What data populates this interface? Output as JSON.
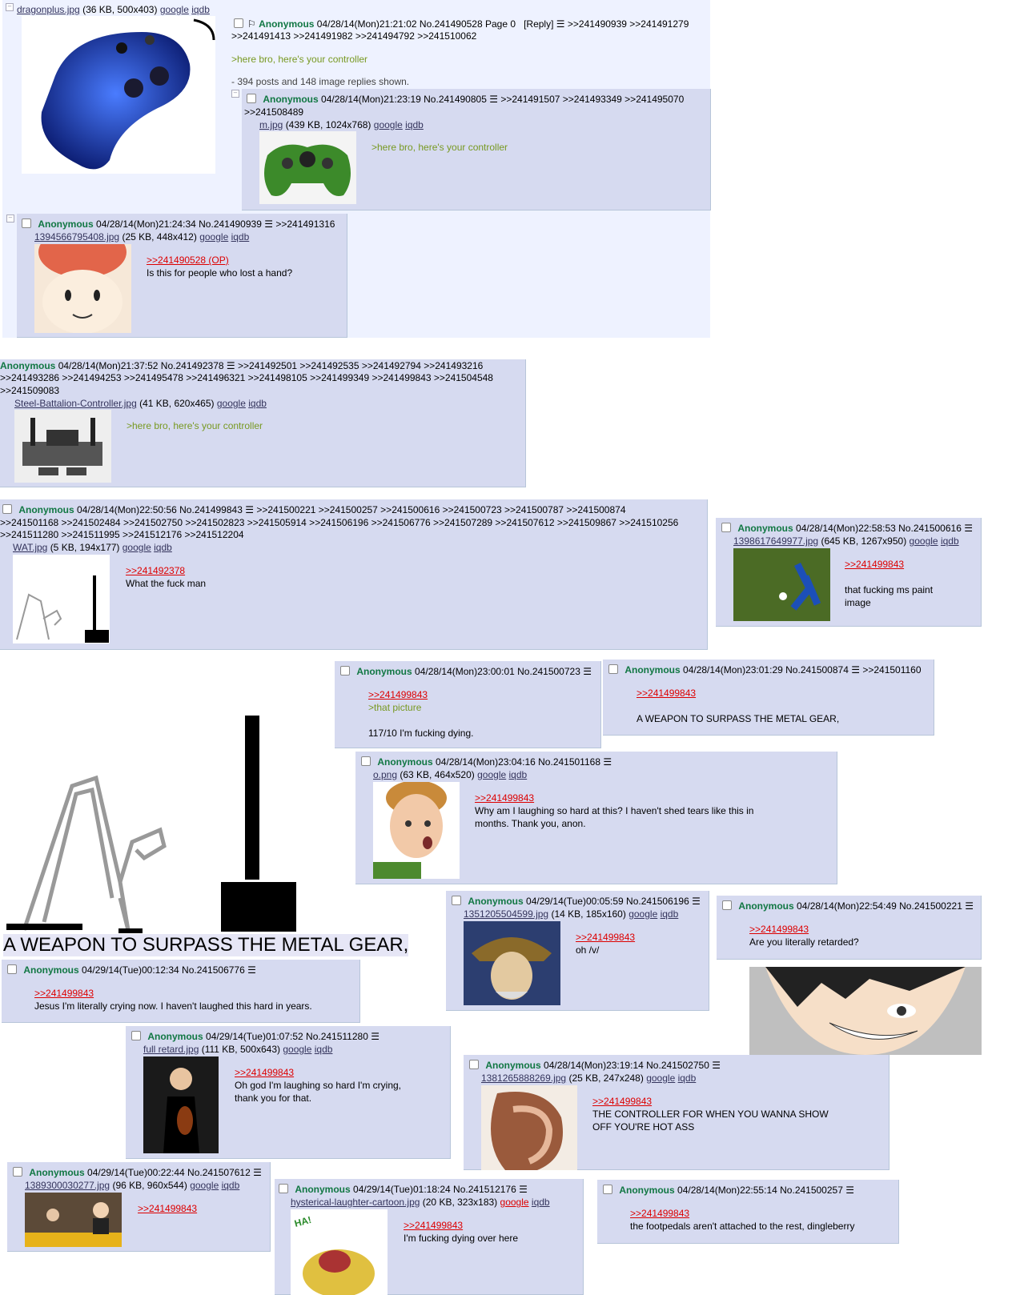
{
  "op": {
    "file_name": "dragonplus.jpg",
    "file_meta": "(36 KB, 500x403)",
    "name": "Anonymous",
    "date": "04/28/14(Mon)21:21:02",
    "no": "No.241490528",
    "page": "Page 0",
    "reply": "[Reply]",
    "replies_line1": ">>241490939 >>241491279",
    "replies_line2": ">>241491413 >>241491982 >>241494792 >>241510062",
    "body": ">here bro, here's your controller",
    "omitted": "- 394 posts and 148 image replies shown."
  },
  "google": "google",
  "iqdb": "iqdb",
  "posts": [
    {
      "name": "Anonymous",
      "date": "04/28/14(Mon)21:23:19",
      "no": "No.241490805",
      "replies": ">>241491507 >>241493349 >>241495070",
      "replies2": ">>241508489",
      "file": "m.jpg",
      "meta": "(439 KB, 1024x768)",
      "body1": ">here bro, here's your controller"
    },
    {
      "name": "Anonymous",
      "date": "04/28/14(Mon)21:24:34",
      "no": "No.241490939",
      "replies": ">>241491316",
      "file": "1394566795408.jpg",
      "meta": "(25 KB, 448x412)",
      "quote": ">>241490528 (OP)",
      "body1": "Is this for people who lost a hand?"
    },
    {
      "name": "Anonymous",
      "date": "04/28/14(Mon)21:37:52",
      "no": "No.241492378",
      "replies": ">>241492501 >>241492535 >>241492794 >>241493216",
      "replies2": ">>241493286 >>241494253 >>241495478 >>241496321 >>241498105 >>241499349 >>241499843 >>241504548",
      "replies3": ">>241509083",
      "file": "Steel-Battalion-Controller.jpg",
      "meta": "(41 KB, 620x465)",
      "body1": ">here bro, here's your controller"
    },
    {
      "name": "Anonymous",
      "date": "04/28/14(Mon)22:50:56",
      "no": "No.241499843",
      "replies": ">>241500221 >>241500257 >>241500616 >>241500723 >>241500787 >>241500874",
      "replies2": ">>241501168 >>241502484 >>241502750 >>241502823 >>241505914 >>241506196 >>241506776 >>241507289 >>241507612 >>241509867 >>241510256",
      "replies3": ">>241511280 >>241511995 >>241512176 >>241512204",
      "file": "WAT.jpg",
      "meta": "(5 KB, 194x177)",
      "quote": ">>241492378",
      "body1": "What the fuck man"
    },
    {
      "name": "Anonymous",
      "date": "04/28/14(Mon)22:58:53",
      "no": "No.241500616",
      "file": "1398617649977.jpg",
      "meta": "(645 KB, 1267x950)",
      "quote": ">>241499843",
      "body1": "that fucking ms paint",
      "body2": "image"
    },
    {
      "name": "Anonymous",
      "date": "04/28/14(Mon)23:00:01",
      "no": "No.241500723",
      "quote": ">>241499843",
      "gt": ">that picture",
      "body1": "117/10 I'm fucking dying."
    },
    {
      "name": "Anonymous",
      "date": "04/28/14(Mon)23:01:29",
      "no": "No.241500874",
      "replies": ">>241501160",
      "quote": ">>241499843",
      "body1": "A WEAPON TO SURPASS THE METAL GEAR,"
    },
    {
      "name": "Anonymous",
      "date": "04/28/14(Mon)23:04:16",
      "no": "No.241501168",
      "file": "o.png",
      "meta": "(63 KB, 464x520)",
      "quote": ">>241499843",
      "body1": "Why am I laughing so hard at this? I haven't shed tears like this in",
      "body2": "months. Thank you, anon."
    },
    {
      "name": "Anonymous",
      "date": "04/29/14(Tue)00:05:59",
      "no": "No.241506196",
      "file": "1351205504599.jpg",
      "meta": "(14 KB, 185x160)",
      "quote": ">>241499843",
      "body1": "oh /v/"
    },
    {
      "name": "Anonymous",
      "date": "04/28/14(Mon)22:54:49",
      "no": "No.241500221",
      "quote": ">>241499843",
      "body1": "Are you literally retarded?"
    },
    {
      "name": "Anonymous",
      "date": "04/29/14(Tue)00:12:34",
      "no": "No.241506776",
      "quote": ">>241499843",
      "body1": "Jesus I'm literally crying now. I haven't laughed this hard in years."
    },
    {
      "name": "Anonymous",
      "date": "04/29/14(Tue)01:07:52",
      "no": "No.241511280",
      "file": "full retard.jpg",
      "meta": "(111 KB, 500x643)",
      "quote": ">>241499843",
      "body1": "Oh god I'm laughing so hard I'm crying,",
      "body2": "thank you for that."
    },
    {
      "name": "Anonymous",
      "date": "04/28/14(Mon)23:19:14",
      "no": "No.241502750",
      "file": "1381265888269.jpg",
      "meta": "(25 KB, 247x248)",
      "quote": ">>241499843",
      "body1": "THE CONTROLLER FOR WHEN YOU WANNA SHOW",
      "body2": "OFF YOU'RE HOT ASS"
    },
    {
      "name": "Anonymous",
      "date": "04/29/14(Tue)00:22:44",
      "no": "No.241507612",
      "file": "1389300030277.jpg",
      "meta": "(96 KB, 960x544)",
      "quote": ">>241499843"
    },
    {
      "name": "Anonymous",
      "date": "04/29/14(Tue)01:18:24",
      "no": "No.241512176",
      "file": "hysterical-laughter-cartoon.jpg",
      "meta": "(20 KB, 323x183)",
      "quote": ">>241499843",
      "body1": "I'm fucking dying over here"
    },
    {
      "name": "Anonymous",
      "date": "04/28/14(Mon)22:55:14",
      "no": "No.241500257",
      "quote": ">>241499843",
      "body1": "the footpedals aren't attached to the rest, dingleberry"
    }
  ],
  "meme_caption": "A WEAPON TO SURPASS THE METAL GEAR,",
  "icons": {
    "menu": "hamburger-icon",
    "bookmark": "bookmark-icon",
    "collapse": "minus-box-icon"
  },
  "colors": {
    "op_bg": "#eef2ff",
    "reply_bg": "#d6daf0",
    "name": "#117743",
    "greentext": "#789922",
    "quotelink": "#dd0000"
  }
}
